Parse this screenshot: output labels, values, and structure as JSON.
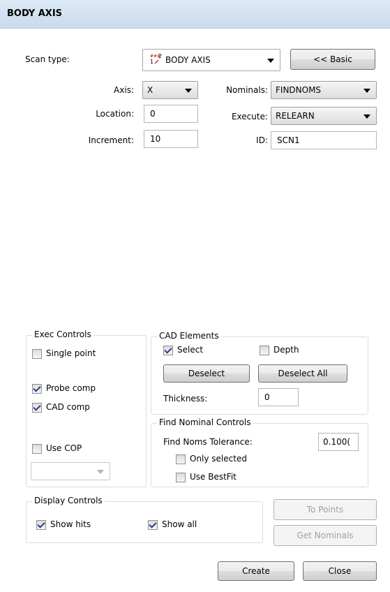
{
  "window": {
    "title": "BODY AXIS"
  },
  "scan": {
    "type_label": "Scan type:",
    "type_value": "BODY AXIS",
    "basic_button": "<< Basic"
  },
  "params": {
    "axis_label": "Axis:",
    "axis_value": "X",
    "location_label": "Location:",
    "location_value": "0",
    "increment_label": "Increment:",
    "increment_value": "10",
    "nominals_label": "Nominals:",
    "nominals_value": "FINDNOMS",
    "execute_label": "Execute:",
    "execute_value": "RELEARN",
    "id_label": "ID:",
    "id_value": "SCN1"
  },
  "exec_controls": {
    "title": "Exec Controls",
    "single_point": {
      "label": "Single point",
      "checked": false
    },
    "probe_comp": {
      "label": "Probe comp",
      "checked": true
    },
    "cad_comp": {
      "label": "CAD comp",
      "checked": true
    },
    "use_cop": {
      "label": "Use COP",
      "checked": false
    },
    "cop_select_value": ""
  },
  "cad_elements": {
    "title": "CAD Elements",
    "select": {
      "label": "Select",
      "checked": true
    },
    "depth": {
      "label": "Depth",
      "checked": false
    },
    "deselect_button": "Deselect",
    "deselect_all_button": "Deselect All",
    "thickness_label": "Thickness:",
    "thickness_value": "0"
  },
  "find_nominal": {
    "title": "Find Nominal Controls",
    "tolerance_label": "Find Noms Tolerance:",
    "tolerance_value": "0.100(",
    "only_selected": {
      "label": "Only selected",
      "checked": false
    },
    "use_bestfit": {
      "label": "Use BestFit",
      "checked": false
    }
  },
  "display_controls": {
    "title": "Display Controls",
    "show_hits": {
      "label": "Show hits",
      "checked": true
    },
    "show_all": {
      "label": "Show all",
      "checked": true
    }
  },
  "actions": {
    "to_points": "To Points",
    "get_nominals": "Get Nominals",
    "create": "Create",
    "close": "Close"
  }
}
